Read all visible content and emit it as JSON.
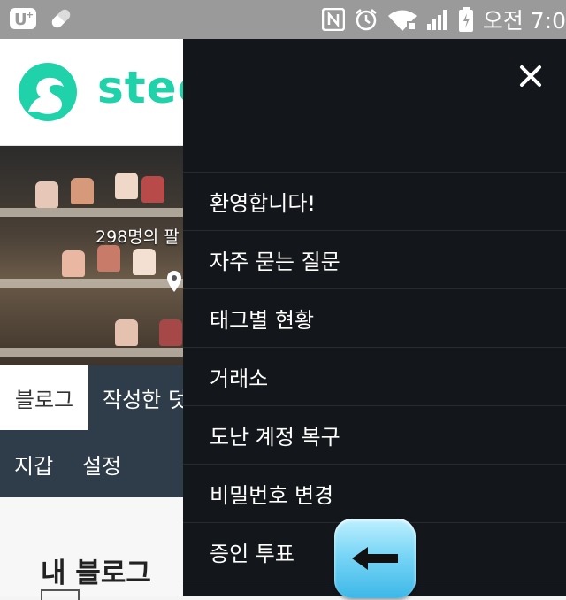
{
  "status_bar": {
    "time": "오전 7:0",
    "left_icons": [
      "u-plus-icon",
      "pill-icon"
    ],
    "right_icons": [
      "nfc-icon",
      "alarm-icon",
      "wifi-icon",
      "signal-icon",
      "battery-icon"
    ]
  },
  "app": {
    "logo_text": "stee",
    "cover": {
      "followers_text": "298명의 팔"
    },
    "tabs": [
      "블로그",
      "작성한 덧"
    ],
    "subtabs": [
      "지갑",
      "설정"
    ],
    "section_title": "내 블로그"
  },
  "drawer": {
    "close_icon": "close-icon",
    "menu_items": [
      "환영합니다!",
      "자주 묻는 질문",
      "태그별 현황",
      "거래소",
      "도난 계정 복구",
      "비밀번호 변경",
      "증인 투표"
    ]
  },
  "overlay": {
    "back_button_icon": "back-arrow-icon"
  },
  "colors": {
    "brand": "#1fd2a9",
    "drawer_bg": "#13171b",
    "tab_bar": "#2e3d49",
    "status_bar": "#9a9a9a"
  }
}
